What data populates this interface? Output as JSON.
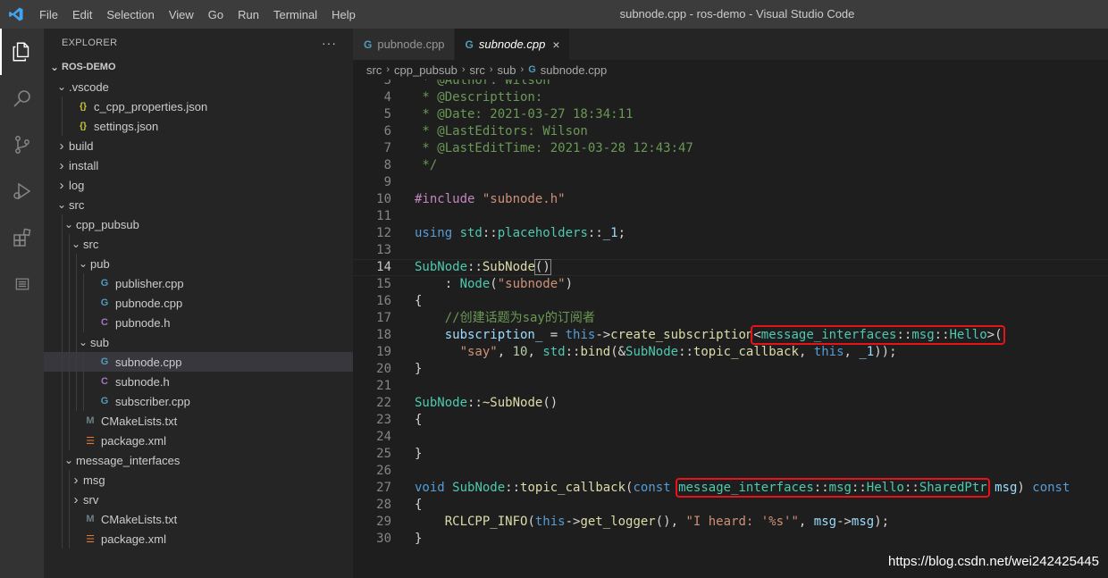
{
  "window": {
    "title": "subnode.cpp - ros-demo - Visual Studio Code"
  },
  "menu": [
    "File",
    "Edit",
    "Selection",
    "View",
    "Go",
    "Run",
    "Terminal",
    "Help"
  ],
  "sidebar": {
    "title": "EXPLORER",
    "more": "···",
    "tree": [
      {
        "label": "ROS-DEMO",
        "depth": 0,
        "kind": "root"
      },
      {
        "label": ".vscode",
        "depth": 1,
        "kind": "folder-open"
      },
      {
        "label": "c_cpp_properties.json",
        "depth": 2,
        "kind": "json"
      },
      {
        "label": "settings.json",
        "depth": 2,
        "kind": "json"
      },
      {
        "label": "build",
        "depth": 1,
        "kind": "folder"
      },
      {
        "label": "install",
        "depth": 1,
        "kind": "folder"
      },
      {
        "label": "log",
        "depth": 1,
        "kind": "folder"
      },
      {
        "label": "src",
        "depth": 1,
        "kind": "folder-open"
      },
      {
        "label": "cpp_pubsub",
        "depth": 2,
        "kind": "folder-open"
      },
      {
        "label": "src",
        "depth": 3,
        "kind": "folder-open"
      },
      {
        "label": "pub",
        "depth": 4,
        "kind": "folder-open"
      },
      {
        "label": "publisher.cpp",
        "depth": 5,
        "kind": "cpp"
      },
      {
        "label": "pubnode.cpp",
        "depth": 5,
        "kind": "cpp"
      },
      {
        "label": "pubnode.h",
        "depth": 5,
        "kind": "h"
      },
      {
        "label": "sub",
        "depth": 4,
        "kind": "folder-open"
      },
      {
        "label": "subnode.cpp",
        "depth": 5,
        "kind": "cpp",
        "selected": true
      },
      {
        "label": "subnode.h",
        "depth": 5,
        "kind": "h"
      },
      {
        "label": "subscriber.cpp",
        "depth": 5,
        "kind": "cpp"
      },
      {
        "label": "CMakeLists.txt",
        "depth": 3,
        "kind": "cmake"
      },
      {
        "label": "package.xml",
        "depth": 3,
        "kind": "xml"
      },
      {
        "label": "message_interfaces",
        "depth": 2,
        "kind": "folder-open"
      },
      {
        "label": "msg",
        "depth": 3,
        "kind": "folder"
      },
      {
        "label": "srv",
        "depth": 3,
        "kind": "folder"
      },
      {
        "label": "CMakeLists.txt",
        "depth": 3,
        "kind": "cmake"
      },
      {
        "label": "package.xml",
        "depth": 3,
        "kind": "xml"
      }
    ]
  },
  "tabs": [
    {
      "label": "pubnode.cpp",
      "active": false
    },
    {
      "label": "subnode.cpp",
      "active": true,
      "close": "×"
    }
  ],
  "breadcrumb": [
    "src",
    "cpp_pubsub",
    "src",
    "sub",
    "subnode.cpp"
  ],
  "editor": {
    "current_line": 14,
    "lines": [
      {
        "n": "3",
        "tokens": [
          [
            "c-com",
            " * @Author: Wilson"
          ]
        ]
      },
      {
        "n": "4",
        "tokens": [
          [
            "c-com",
            " * @Descripttion:"
          ]
        ]
      },
      {
        "n": "5",
        "tokens": [
          [
            "c-com",
            " * @Date: 2021-03-27 18:34:11"
          ]
        ]
      },
      {
        "n": "6",
        "tokens": [
          [
            "c-com",
            " * @LastEditors: Wilson"
          ]
        ]
      },
      {
        "n": "7",
        "tokens": [
          [
            "c-com",
            " * @LastEditTime: 2021-03-28 12:43:47"
          ]
        ]
      },
      {
        "n": "8",
        "tokens": [
          [
            "c-com",
            " */"
          ]
        ]
      },
      {
        "n": "9",
        "tokens": []
      },
      {
        "n": "10",
        "tokens": [
          [
            "c-pp",
            "#include "
          ],
          [
            "c-str",
            "\"subnode.h\""
          ]
        ]
      },
      {
        "n": "11",
        "tokens": []
      },
      {
        "n": "12",
        "tokens": [
          [
            "c-kw",
            "using "
          ],
          [
            "c-type",
            "std"
          ],
          [
            "c-plain",
            "::"
          ],
          [
            "c-type",
            "placeholders"
          ],
          [
            "c-plain",
            "::"
          ],
          [
            "c-var",
            "_1"
          ],
          [
            "c-plain",
            ";"
          ]
        ]
      },
      {
        "n": "13",
        "tokens": []
      },
      {
        "n": "14",
        "tokens": [
          [
            "c-type",
            "SubNode"
          ],
          [
            "c-plain",
            "::"
          ],
          [
            "c-fn",
            "SubNode"
          ],
          [
            "c-plain bracket-box",
            "()"
          ]
        ]
      },
      {
        "n": "15",
        "tokens": [
          [
            "c-plain",
            "    : "
          ],
          [
            "c-type",
            "Node"
          ],
          [
            "c-plain",
            "("
          ],
          [
            "c-str",
            "\"subnode\""
          ],
          [
            "c-plain",
            ")"
          ]
        ]
      },
      {
        "n": "16",
        "tokens": [
          [
            "c-plain",
            "{"
          ]
        ]
      },
      {
        "n": "17",
        "tokens": [
          [
            "c-com",
            "    //创建话题为say的订阅者"
          ]
        ]
      },
      {
        "n": "18",
        "tokens": [
          [
            "c-plain",
            "    "
          ],
          [
            "c-var",
            "subscription_"
          ],
          [
            "c-plain",
            " = "
          ],
          [
            "c-kw",
            "this"
          ],
          [
            "c-plain",
            "->"
          ],
          [
            "c-fn",
            "create_subscription"
          ],
          [
            "c-plain",
            "<"
          ],
          [
            "c-type",
            "message_interfaces"
          ],
          [
            "c-plain",
            "::"
          ],
          [
            "c-type",
            "msg"
          ],
          [
            "c-plain",
            "::"
          ],
          [
            "c-type",
            "Hello"
          ],
          [
            "c-plain",
            ">("
          ]
        ]
      },
      {
        "n": "19",
        "tokens": [
          [
            "c-plain",
            "      "
          ],
          [
            "c-str",
            "\"say\""
          ],
          [
            "c-plain",
            ", "
          ],
          [
            "c-num",
            "10"
          ],
          [
            "c-plain",
            ", "
          ],
          [
            "c-type",
            "std"
          ],
          [
            "c-plain",
            "::"
          ],
          [
            "c-fn",
            "bind"
          ],
          [
            "c-plain",
            "(&"
          ],
          [
            "c-type",
            "SubNode"
          ],
          [
            "c-plain",
            "::"
          ],
          [
            "c-fn",
            "topic_callback"
          ],
          [
            "c-plain",
            ", "
          ],
          [
            "c-kw",
            "this"
          ],
          [
            "c-plain",
            ", "
          ],
          [
            "c-var",
            "_1"
          ],
          [
            "c-plain",
            "));"
          ]
        ]
      },
      {
        "n": "20",
        "tokens": [
          [
            "c-plain",
            "}"
          ]
        ]
      },
      {
        "n": "21",
        "tokens": []
      },
      {
        "n": "22",
        "tokens": [
          [
            "c-type",
            "SubNode"
          ],
          [
            "c-plain",
            "::"
          ],
          [
            "c-fn",
            "~SubNode"
          ],
          [
            "c-plain",
            "()"
          ]
        ]
      },
      {
        "n": "23",
        "tokens": [
          [
            "c-plain",
            "{"
          ]
        ]
      },
      {
        "n": "24",
        "tokens": []
      },
      {
        "n": "25",
        "tokens": [
          [
            "c-plain",
            "}"
          ]
        ]
      },
      {
        "n": "26",
        "tokens": []
      },
      {
        "n": "27",
        "tokens": [
          [
            "c-kw",
            "void "
          ],
          [
            "c-type",
            "SubNode"
          ],
          [
            "c-plain",
            "::"
          ],
          [
            "c-fn",
            "topic_callback"
          ],
          [
            "c-plain",
            "("
          ],
          [
            "c-kw",
            "const "
          ],
          [
            "c-type",
            "message_interfaces"
          ],
          [
            "c-plain",
            "::"
          ],
          [
            "c-type",
            "msg"
          ],
          [
            "c-plain",
            "::"
          ],
          [
            "c-type",
            "Hello"
          ],
          [
            "c-plain",
            "::"
          ],
          [
            "c-type",
            "SharedPtr"
          ],
          [
            "c-plain",
            " "
          ],
          [
            "c-var",
            "msg"
          ],
          [
            "c-plain",
            ") "
          ],
          [
            "c-kw",
            "const"
          ]
        ]
      },
      {
        "n": "28",
        "tokens": [
          [
            "c-plain",
            "{"
          ]
        ]
      },
      {
        "n": "29",
        "tokens": [
          [
            "c-plain",
            "    "
          ],
          [
            "c-fn",
            "RCLCPP_INFO"
          ],
          [
            "c-plain",
            "("
          ],
          [
            "c-kw",
            "this"
          ],
          [
            "c-plain",
            "->"
          ],
          [
            "c-fn",
            "get_logger"
          ],
          [
            "c-plain",
            "(), "
          ],
          [
            "c-str",
            "\"I heard: '%s'\""
          ],
          [
            "c-plain",
            ", "
          ],
          [
            "c-var",
            "msg"
          ],
          [
            "c-plain",
            "->"
          ],
          [
            "c-var",
            "msg"
          ],
          [
            "c-plain",
            ");"
          ]
        ]
      },
      {
        "n": "30",
        "tokens": [
          [
            "c-plain",
            "}"
          ]
        ]
      }
    ]
  },
  "watermark": "https://blog.csdn.net/wei242425445",
  "colors": {
    "highlight_box": "#e8121a",
    "accent": "#007acc"
  }
}
